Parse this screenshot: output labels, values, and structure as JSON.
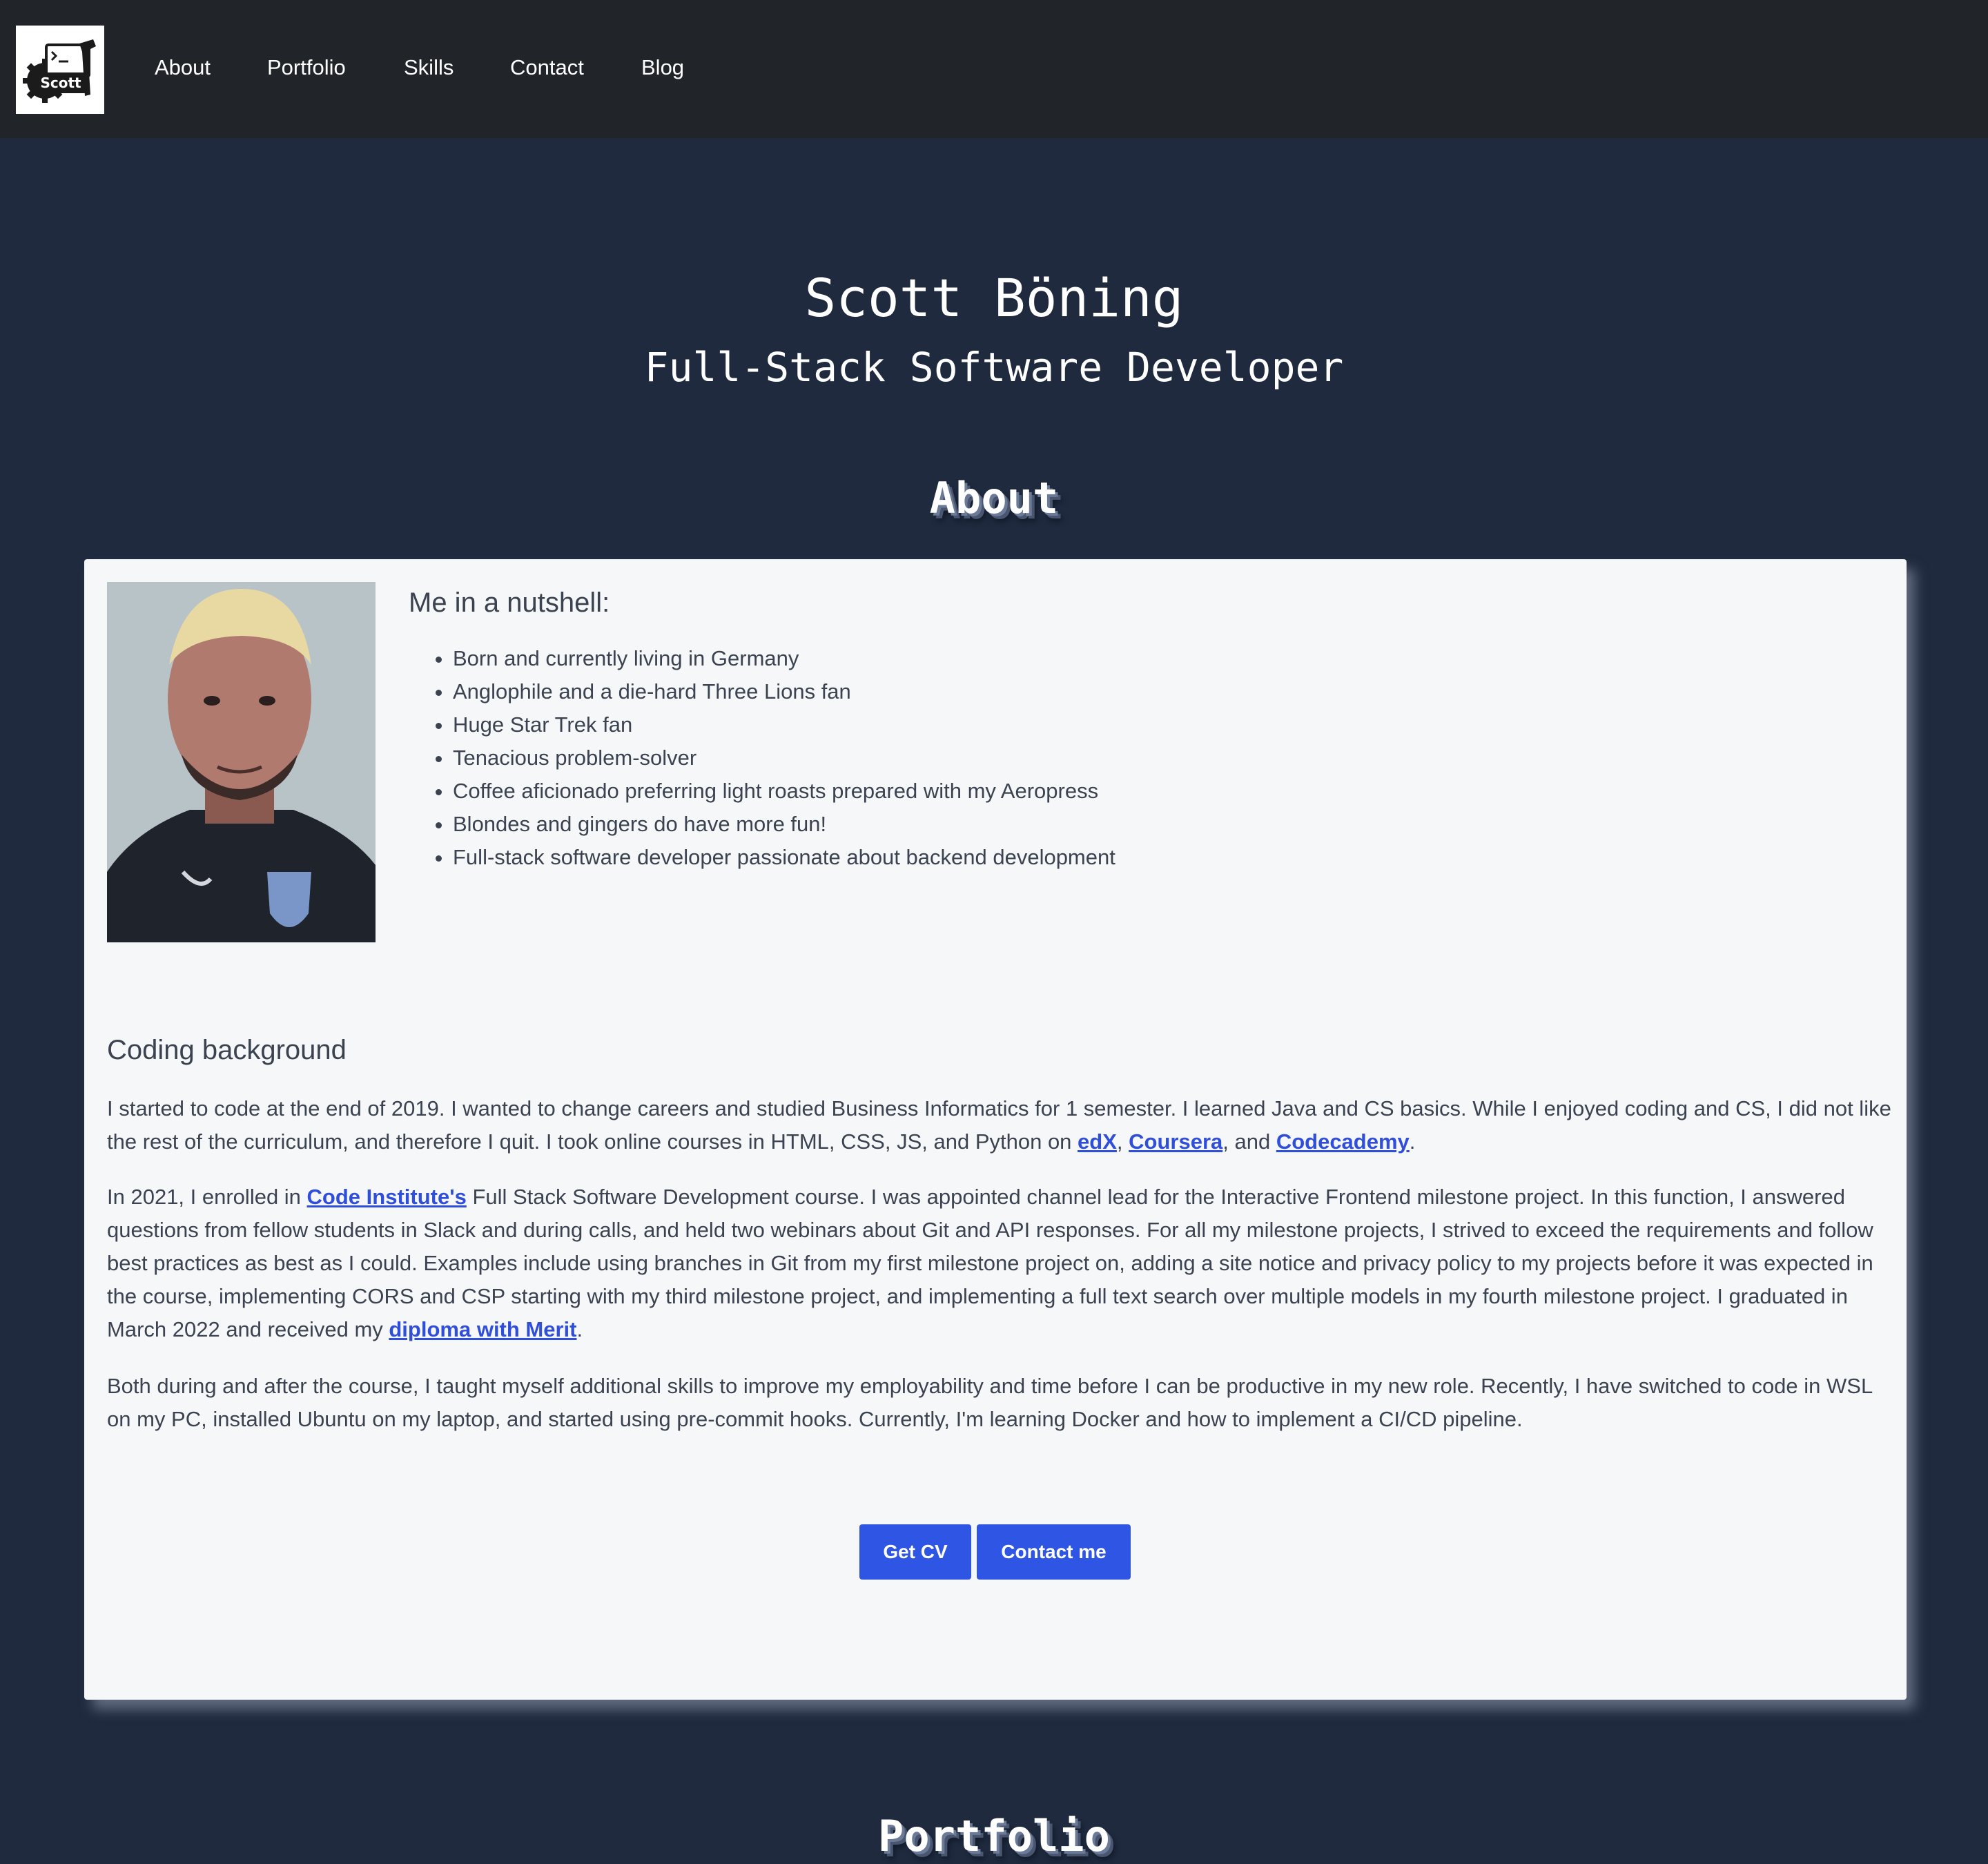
{
  "nav": {
    "logo_text": "Scott",
    "links": [
      "About",
      "Portfolio",
      "Skills",
      "Contact",
      "Blog"
    ]
  },
  "hero": {
    "name": "Scott Böning",
    "role": "Full-Stack Software Developer"
  },
  "about": {
    "title": "About",
    "nutshell_heading": "Me in a nutshell:",
    "nutshell_items": [
      "Born and currently living in Germany",
      "Anglophile and a die-hard Three Lions fan",
      "Huge Star Trek fan",
      "Tenacious problem-solver",
      "Coffee aficionado preferring light roasts prepared with my Aeropress",
      "Blondes and gingers do have more fun!",
      "Full-stack software developer passionate about backend development"
    ],
    "coding_heading": "Coding background",
    "p1": {
      "text_a": "I started to code at the end of 2019. I wanted to change careers and studied Business Informatics for 1 semester. I learned Java and CS basics. While I enjoyed coding and CS, I did not like the rest of the curriculum, and therefore I quit. I took online courses in HTML, CSS, JS, and Python on ",
      "link_edx": "edX",
      "sep_1": ", ",
      "link_coursera": "Coursera",
      "sep_2": ", and ",
      "link_codecademy": "Codecademy",
      "end": "."
    },
    "p2": {
      "text_a": "In 2021, I enrolled in ",
      "link_ci": "Code Institute's",
      "text_b": " Full Stack Software Development course. I was appointed channel lead for the Interactive Frontend milestone project. In this function, I answered questions from fellow students in Slack and during calls, and held two webinars about Git and API responses. For all my milestone projects, I strived to exceed the requirements and follow best practices as best as I could. Examples include using branches in Git from my first milestone project on, adding a site notice and privacy policy to my projects before it was expected in the course, implementing CORS and CSP starting with my third milestone project, and implementing a full text search over multiple models in my fourth milestone project. I graduated in March 2022 and received my ",
      "link_diploma": "diploma with Merit",
      "end": "."
    },
    "p3": "Both during and after the course, I taught myself additional skills to improve my employability and time before I can be productive in my new role. Recently, I have switched to code in WSL on my PC, installed Ubuntu on my laptop, and started using pre-commit hooks. Currently, I'm learning Docker and how to implement a CI/CD pipeline.",
    "buttons": {
      "cv": "Get CV",
      "contact": "Contact me"
    }
  },
  "portfolio": {
    "title": "Portfolio"
  },
  "colors": {
    "page_bg": "#1f2a3e",
    "navbar_bg": "#212529",
    "card_bg": "#f6f7f9",
    "link": "#2f4fdb",
    "button": "#2f55e4"
  }
}
